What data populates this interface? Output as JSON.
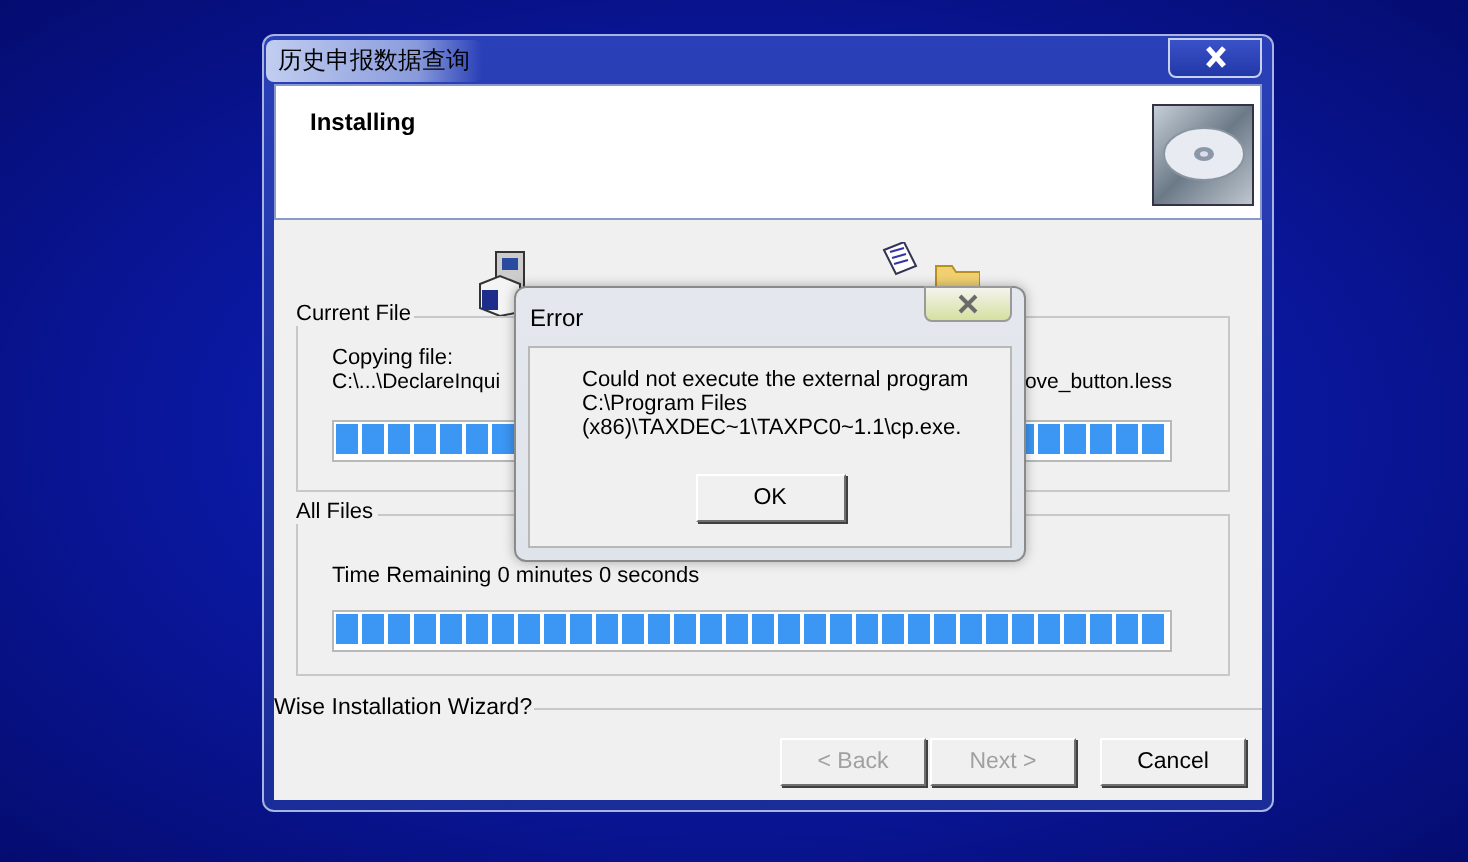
{
  "window": {
    "title": "历史申报数据查询",
    "header": "Installing"
  },
  "current_file": {
    "label": "Current File",
    "copying": "Copying file:",
    "path_left": "C:\\...\\DeclareInqui",
    "path_right": "ove_button.less",
    "level": 1
  },
  "all_files": {
    "label": "All Files",
    "time_remaining": "Time Remaining 0 minutes 0 seconds",
    "level": 1
  },
  "footer": {
    "label": "Wise Installation Wizard?"
  },
  "buttons": [
    {
      "label": "< Back",
      "disabled": true
    },
    {
      "label": "Next >",
      "disabled": true
    },
    {
      "label": "Cancel",
      "disabled": false
    }
  ],
  "error_dialog": {
    "title": "Error",
    "message": [
      "Could not execute the external program",
      "C:\\Program Files",
      "(x86)\\TAXDEC~1\\TAXPC0~1.1\\cp.exe."
    ],
    "button": "OK"
  }
}
